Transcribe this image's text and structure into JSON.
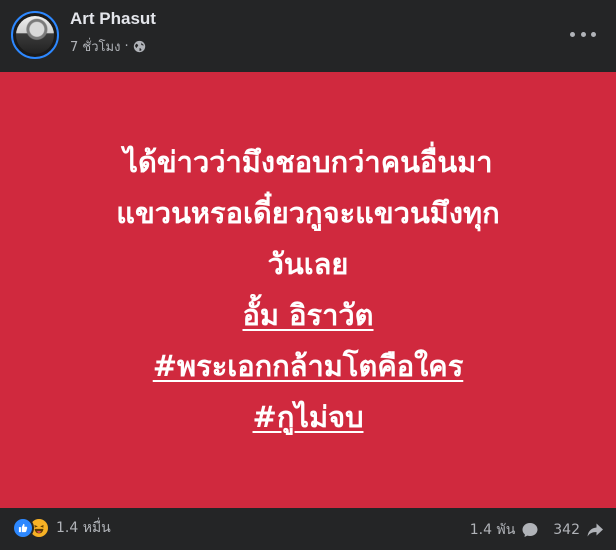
{
  "post": {
    "author": "Art Phasut",
    "time": "7 ชั่วโมง",
    "separator": "·",
    "privacy_icon": "globe-icon",
    "menu_icon": "more-horizontal-icon",
    "background_color": "#d0293e",
    "lines": [
      "ได้ข่าวว่ามึงชอบกว่าคนอื่นมา",
      "แขวนหรอเดี๋ยวกูจะแขวนมึงทุก",
      "วันเลย",
      "อั้ม อิราวัต",
      "#พระเอกกล้ามโตคือใคร",
      "#กูไม่จบ"
    ]
  },
  "footer": {
    "reaction_icons": [
      "like-icon",
      "haha-icon"
    ],
    "reaction_count": "1.4 หมื่น",
    "comment_count": "1.4 พัน",
    "comment_icon": "comment-icon",
    "share_count": "342",
    "share_icon": "share-icon"
  }
}
